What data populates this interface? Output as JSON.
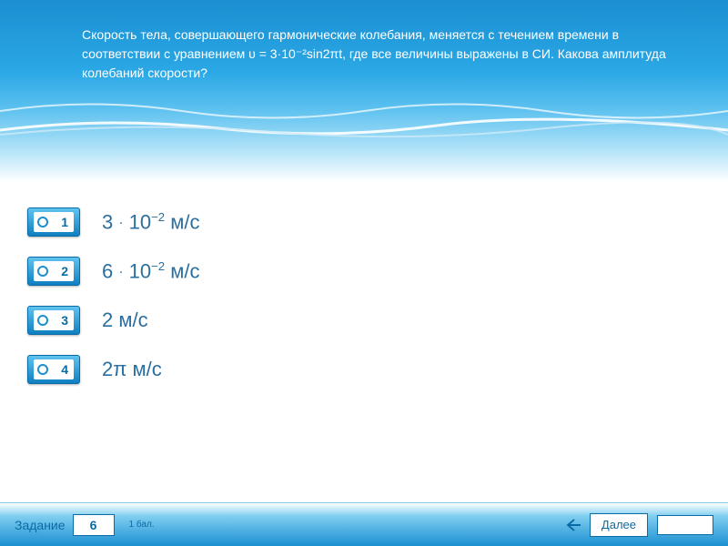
{
  "question": "Скорость тела, совершающего гармонические колебания, меняется с течением времени в соответствии с уравнением υ = 3·10⁻²sin2πt, где все величины выражены в СИ. Какова амплитуда колебаний скорости?",
  "options": [
    {
      "num": "1",
      "text": "3 · 10⁻² м/с"
    },
    {
      "num": "2",
      "text": "6 · 10⁻² м/с"
    },
    {
      "num": "3",
      "text": "2 м/с"
    },
    {
      "num": "4",
      "text": "2π м/с"
    }
  ],
  "footer": {
    "task_label": "Задание",
    "task_number": "6",
    "points": "1 бал.",
    "next_label": "Далее"
  }
}
